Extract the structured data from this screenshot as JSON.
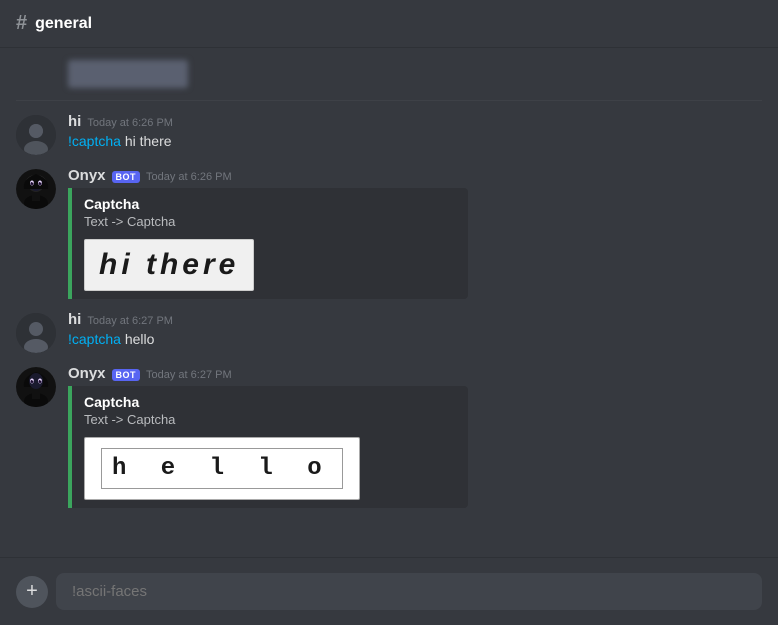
{
  "header": {
    "hash": "#",
    "channel": "general"
  },
  "messages": [
    {
      "id": "blurred",
      "type": "blurred"
    },
    {
      "id": "hi-1",
      "type": "user",
      "username": "hi",
      "timestamp": "Today at 6:26 PM",
      "text": "!captcha hi there",
      "command_part": "!captcha",
      "rest": " hi there"
    },
    {
      "id": "onyx-1",
      "type": "bot",
      "username": "Onyx",
      "bot_label": "BOT",
      "timestamp": "Today at 6:26 PM",
      "embed_title": "Captcha",
      "embed_field": "Text -> Captcha",
      "captcha_text": "hi there",
      "captcha_style": "hi-there"
    },
    {
      "id": "hi-2",
      "type": "user",
      "username": "hi",
      "timestamp": "Today at 6:27 PM",
      "text": "!captcha hello",
      "command_part": "!captcha",
      "rest": " hello"
    },
    {
      "id": "onyx-2",
      "type": "bot",
      "username": "Onyx",
      "bot_label": "BOT",
      "timestamp": "Today at 6:27 PM",
      "embed_title": "Captcha",
      "embed_field": "Text -> Captcha",
      "captcha_text": "hello",
      "captcha_style": "hello"
    }
  ],
  "input": {
    "placeholder": "!ascii-faces",
    "add_button": "+"
  }
}
